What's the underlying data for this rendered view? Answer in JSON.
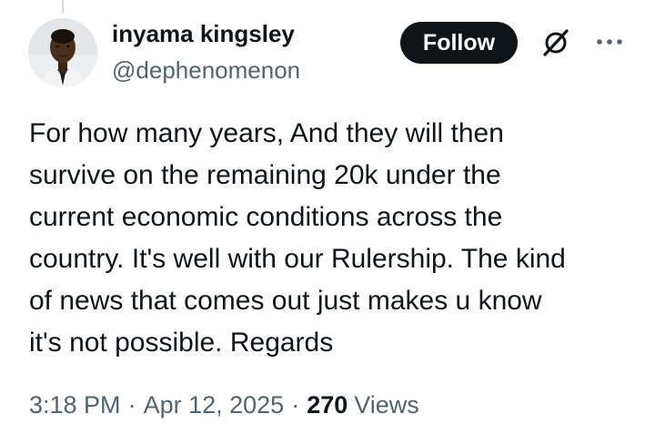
{
  "author": {
    "display_name": "inyama kingsley",
    "handle": "@dephenomenon",
    "avatar_icon": "profile-photo"
  },
  "actions": {
    "follow_label": "Follow",
    "grok_icon": "grok-icon",
    "more_icon": "more-horizontal-icon"
  },
  "tweet": {
    "text_lines": [
      "For how many years, And they will then",
      "survive on the remaining 20k under the",
      "current economic conditions across the",
      "country. It's well with our Rulership. The kind",
      "of news that comes out just makes u know",
      "it's not possible. Regards"
    ]
  },
  "meta": {
    "time": "3:18 PM",
    "separator": "·",
    "date": "Apr 12, 2025",
    "views_count": "270",
    "views_label": "Views"
  },
  "colors": {
    "text_primary": "#0f1419",
    "text_secondary": "#536471",
    "follow_bg": "#0f1419",
    "follow_text": "#ffffff",
    "thread_line": "#cfd9de"
  }
}
